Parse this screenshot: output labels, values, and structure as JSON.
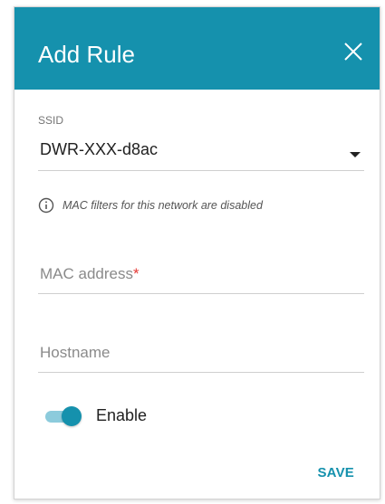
{
  "colors": {
    "accent": "#1591ad",
    "required": "#e53935"
  },
  "dialog": {
    "title": "Add Rule",
    "close_icon": "close-icon",
    "ssid": {
      "label": "SSID",
      "value": "DWR-XXX-d8ac"
    },
    "info": {
      "icon": "info-icon",
      "text": "MAC filters for this network are disabled"
    },
    "mac_address": {
      "placeholder": "MAC address",
      "required_mark": "*"
    },
    "hostname": {
      "placeholder": "Hostname"
    },
    "enable": {
      "label": "Enable",
      "checked": true
    },
    "save_label": "SAVE"
  }
}
